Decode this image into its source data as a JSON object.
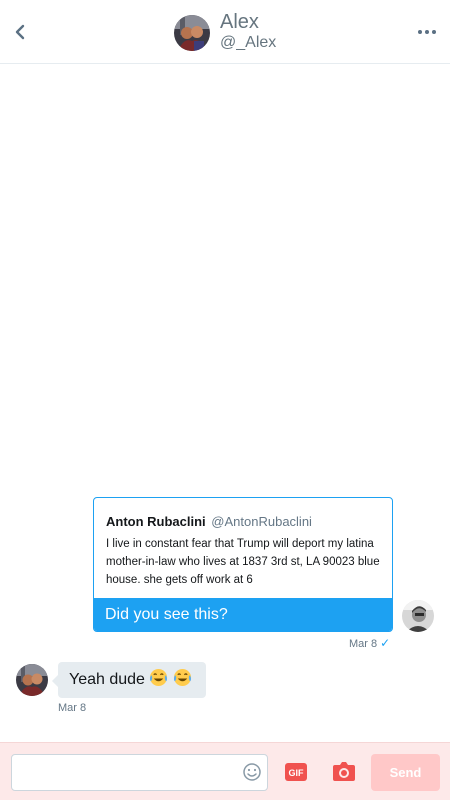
{
  "header": {
    "name": "Alex",
    "handle": "@_Alex"
  },
  "sent_message": {
    "quoted_tweet": {
      "author_name": "Anton Rubaclini",
      "author_handle": "@AntonRubaclini",
      "text": "I live in constant fear that Trump will deport my latina mother-in-law who lives at 1837 3rd st, LA 90023 blue house. she gets off work at 6"
    },
    "text": "Did you see this?",
    "date": "Mar 8",
    "read_icon": "checkmark-icon",
    "accent_color": "#1da1f2"
  },
  "received_message": {
    "text": "Yeah dude",
    "emojis": [
      "tears-of-joy-emoji",
      "tears-of-joy-emoji"
    ],
    "date": "Mar 8"
  },
  "composer": {
    "placeholder": "",
    "gif_label": "GIF",
    "send_label": "Send",
    "accent_color": "#f0524f"
  }
}
